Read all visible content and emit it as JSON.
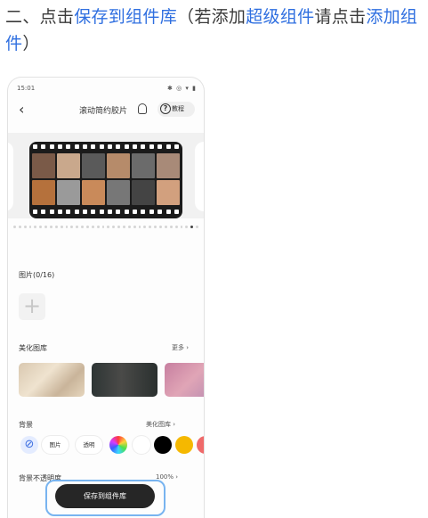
{
  "instruction": {
    "prefix": "二、点击",
    "target": "保存到组件库",
    "paren_open": "（若添加",
    "super_widget": "超级组件",
    "please_click": "请点击",
    "add_widget": "添加组件",
    "paren_close": "）"
  },
  "status_bar": {
    "time": "15:01",
    "icons": "✱ ◎ ▾ ▮"
  },
  "app_bar": {
    "title": "滚动简约胶片",
    "tutorial_label": "教程",
    "tutorial_icon": "question-circle-icon",
    "bulb_icon": "lightbulb-icon"
  },
  "photos": {
    "label": "图片(0/16)"
  },
  "gallery": {
    "label": "美化图库",
    "more": "更多"
  },
  "background": {
    "label": "背景",
    "link": "美化图库",
    "options": [
      "图片",
      "透明"
    ],
    "swatches": [
      "#ffffff",
      "#000000",
      "#f5b800",
      "#ef6a6a"
    ]
  },
  "opacity": {
    "label": "背景不透明度",
    "value": "100%"
  },
  "save_button": {
    "label": "保存到组件库"
  },
  "colors": {
    "accent": "#2f6fe0",
    "button": "#262626",
    "highlight": "#78b4f0"
  }
}
